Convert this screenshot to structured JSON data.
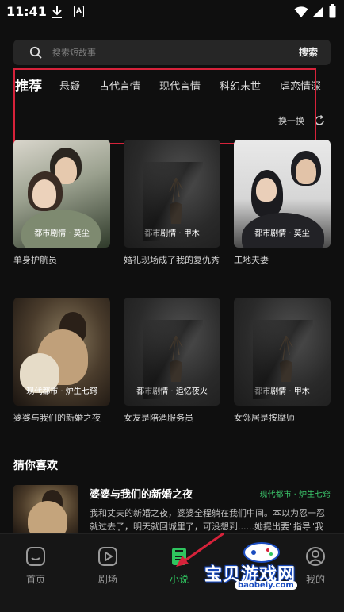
{
  "status_bar": {
    "time": "11:41",
    "a_badge": "A"
  },
  "search": {
    "placeholder": "搜索短故事",
    "button_label": "搜索"
  },
  "categories": [
    "推荐",
    "悬疑",
    "古代言情",
    "现代言情",
    "科幻末世",
    "虐恋情深"
  ],
  "refresh_label": "换一换",
  "books": [
    {
      "tag": "都市剧情 · 莫尘",
      "title": "单身护航员"
    },
    {
      "tag": "都市剧情 · 甲木",
      "title": "婚礼现场成了我的复仇秀"
    },
    {
      "tag": "都市剧情 · 莫尘",
      "title": "工地夫妻"
    },
    {
      "tag": "现代都市 · 炉生七窍",
      "title": "婆婆与我们的新婚之夜"
    },
    {
      "tag": "都市剧情 · 追忆夜火",
      "title": "女友是陪酒服务员"
    },
    {
      "tag": "都市剧情 · 甲木",
      "title": "女邻居是按摩师"
    }
  ],
  "guess": {
    "heading": "猜你喜欢",
    "item": {
      "title": "婆婆与我们的新婚之夜",
      "tag": "现代都市 · 炉生七窍",
      "desc": "我和丈夫的新婚之夜，婆婆全程躺在我们中间。本以为忍一忍就过去了，明天就回城里了，可没想到......她提出要\"指导\"我"
    }
  },
  "nav": [
    {
      "label": "首页",
      "icon": "home-icon"
    },
    {
      "label": "剧场",
      "icon": "play-icon"
    },
    {
      "label": "小说",
      "icon": "book-icon"
    },
    {
      "label": "我的",
      "icon": "user-icon"
    }
  ],
  "watermark": {
    "text": "宝贝游戏网",
    "url": "baobeiy.com"
  },
  "colors": {
    "accent": "#2fc45f",
    "highlight": "#d6223a",
    "background": "#0f0f0f"
  }
}
